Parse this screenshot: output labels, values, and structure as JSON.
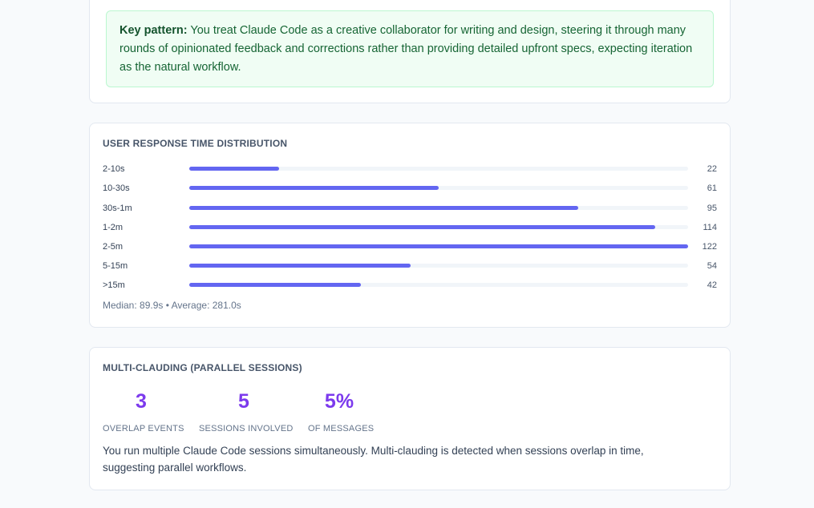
{
  "pattern": {
    "label": "Key pattern:",
    "text": " You treat Claude Code as a creative collaborator for writing and design, steering it through many rounds of opinionated feedback and corrections rather than providing detailed upfront specs, expecting iteration as the natural workflow."
  },
  "response_time": {
    "title": "User Response Time Distribution",
    "accent_color": "#6366f1",
    "bars": [
      {
        "label": "2-10s",
        "value": "22",
        "fraction": 0.18
      },
      {
        "label": "10-30s",
        "value": "61",
        "fraction": 0.5
      },
      {
        "label": "30s-1m",
        "value": "95",
        "fraction": 0.779
      },
      {
        "label": "1-2m",
        "value": "114",
        "fraction": 0.934
      },
      {
        "label": "2-5m",
        "value": "122",
        "fraction": 1.0
      },
      {
        "label": "5-15m",
        "value": "54",
        "fraction": 0.443
      },
      {
        "label": ">15m",
        "value": "42",
        "fraction": 0.344
      }
    ],
    "footnote": "Median: 89.9s • Average: 281.0s"
  },
  "multi": {
    "title": "Multi-Clauding (Parallel Sessions)",
    "accent_color": "#7c3aed",
    "stats": [
      {
        "value": "3",
        "label": "Overlap Events"
      },
      {
        "value": "5",
        "label": "Sessions Involved"
      },
      {
        "value": "5%",
        "label": "of Messages"
      }
    ],
    "description": "You run multiple Claude Code sessions simultaneously. Multi-clauding is detected when sessions overlap in time, suggesting parallel workflows."
  }
}
